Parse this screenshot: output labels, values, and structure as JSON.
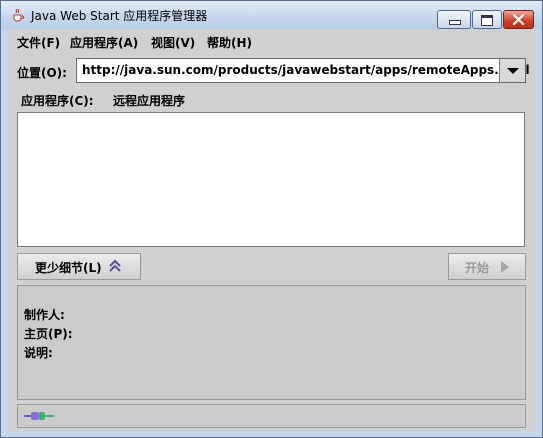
{
  "window": {
    "title": "Java Web Start 应用程序管理器"
  },
  "menu": {
    "file": "文件(F)",
    "apps": "应用程序(A)",
    "view": "视图(V)",
    "help": "帮助(H)"
  },
  "location": {
    "label": "位置(O):",
    "value": "http://java.sun.com/products/javawebstart/apps/remoteApps.html"
  },
  "applications": {
    "label": "应用程序(C):",
    "selected": "远程应用程序"
  },
  "buttons": {
    "less_details": "更少细节(L)",
    "start": "开始"
  },
  "details": {
    "vendor": "制作人:",
    "homepage": "主页(P):",
    "description": "说明:"
  },
  "icons": {
    "app": "java-cup-icon",
    "collapse": "double-chevron-up-icon",
    "start": "play-icon",
    "status": "plug-icon"
  }
}
